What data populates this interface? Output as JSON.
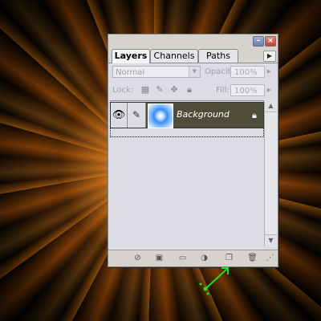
{
  "layers_panel": {
    "tabs": [
      {
        "label": "Layers",
        "active": true
      },
      {
        "label": "Channels",
        "active": false
      },
      {
        "label": "Paths",
        "active": false
      }
    ],
    "blend_mode": "Normal",
    "opacity_label": "Opacity:",
    "opacity_value": "100%",
    "lock_label": "Lock:",
    "fill_label": "Fill:",
    "fill_value": "100%",
    "layers": [
      {
        "name": "Background",
        "visible": true,
        "locked": true,
        "selected": true
      }
    ],
    "bottom_icons": [
      "link-layers-icon",
      "layer-style-icon",
      "add-mask-icon",
      "new-fill-adjustment-icon",
      "new-layer-icon",
      "delete-layer-icon"
    ]
  },
  "colors": {
    "background_glow": "#ff9a20",
    "selected_layer_row": "#4d4d3a",
    "annotation_arrow": "#22dd22",
    "close_button": "#c2402c"
  }
}
